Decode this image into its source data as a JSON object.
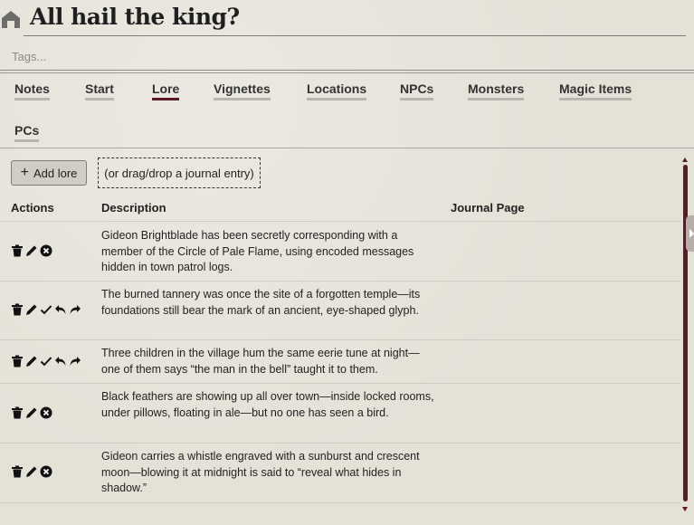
{
  "header": {
    "title": "All hail the king?",
    "home_icon": "home-icon"
  },
  "tags": {
    "placeholder": "Tags..."
  },
  "tabs": [
    {
      "label": "Notes"
    },
    {
      "label": "Start"
    },
    {
      "label": "Lore",
      "active": true
    },
    {
      "label": "Vignettes"
    },
    {
      "label": "Locations"
    },
    {
      "label": "NPCs"
    },
    {
      "label": "Monsters"
    },
    {
      "label": "Magic Items"
    },
    {
      "label": "PCs"
    }
  ],
  "toolbar": {
    "add_label": "Add lore",
    "drop_hint": "(or drag/drop a journal entry)"
  },
  "table": {
    "headers": {
      "actions": "Actions",
      "description": "Description",
      "journal": "Journal Page"
    },
    "rows": [
      {
        "icons": [
          "trash-icon",
          "edit-icon",
          "close-circle-icon"
        ],
        "description": "Gideon Brightblade has been secretly corresponding with a member of the Circle of Pale Flame, using encoded messages hidden in town patrol logs."
      },
      {
        "icons": [
          "trash-icon",
          "edit-icon",
          "check-icon",
          "undo-icon",
          "redo-icon"
        ],
        "description": "The burned tannery was once the site of a forgotten temple—its foundations still bear the mark of an ancient, eye-shaped glyph."
      },
      {
        "icons": [
          "trash-icon",
          "edit-icon",
          "check-icon",
          "undo-icon",
          "redo-icon"
        ],
        "description": "Three children in the village hum the same eerie tune at night—one of them says “the man in the bell” taught it to them."
      },
      {
        "icons": [
          "trash-icon",
          "edit-icon",
          "close-circle-icon"
        ],
        "description": "Black feathers are showing up all over town—inside locked rooms, under pillows, floating in ale—but no one has seen a bird."
      },
      {
        "icons": [
          "trash-icon",
          "edit-icon",
          "close-circle-icon"
        ],
        "description": "Gideon carries a whistle engraved with a sunburst and crescent moon—blowing it at midnight is said to “reveal what hides in shadow.”"
      }
    ]
  },
  "colors": {
    "accent": "#5c1a25",
    "tab_underline": "#b8b6ae",
    "background": "#e4e1d7"
  }
}
